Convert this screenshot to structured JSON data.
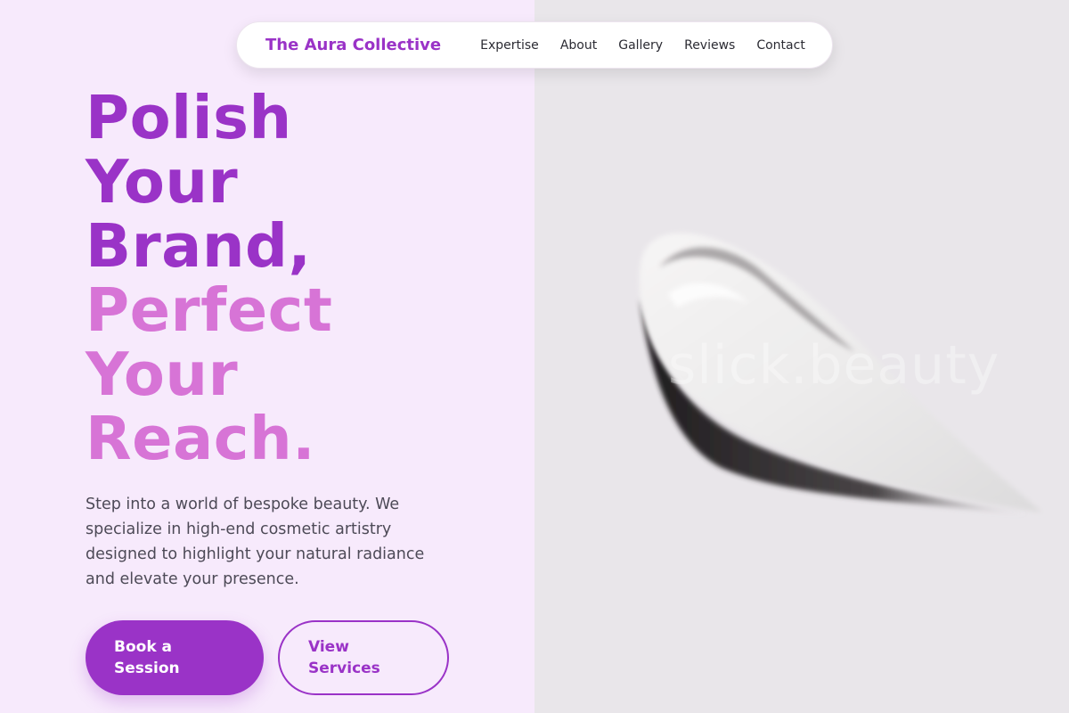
{
  "nav": {
    "brand": "The Aura Collective",
    "links": [
      "Expertise",
      "About",
      "Gallery",
      "Reviews",
      "Contact"
    ]
  },
  "hero": {
    "headline_dark": [
      "Polish",
      "Your",
      "Brand,"
    ],
    "headline_light": [
      "Perfect",
      "Your",
      "Reach."
    ],
    "description": "Step into a world of bespoke beauty. We specialize in high-end cosmetic artistry designed to highlight your natural radiance and elevate your presence.",
    "primary_button": "Book a Session",
    "secondary_button": "View Services"
  },
  "image": {
    "subject": "cream-swatch-image",
    "watermark": "slick.beauty"
  },
  "colors": {
    "accent": "#9a33c7",
    "accent_light": "#d774d6",
    "left_background": "#f7eafc",
    "right_background": "#e9e6ea"
  }
}
